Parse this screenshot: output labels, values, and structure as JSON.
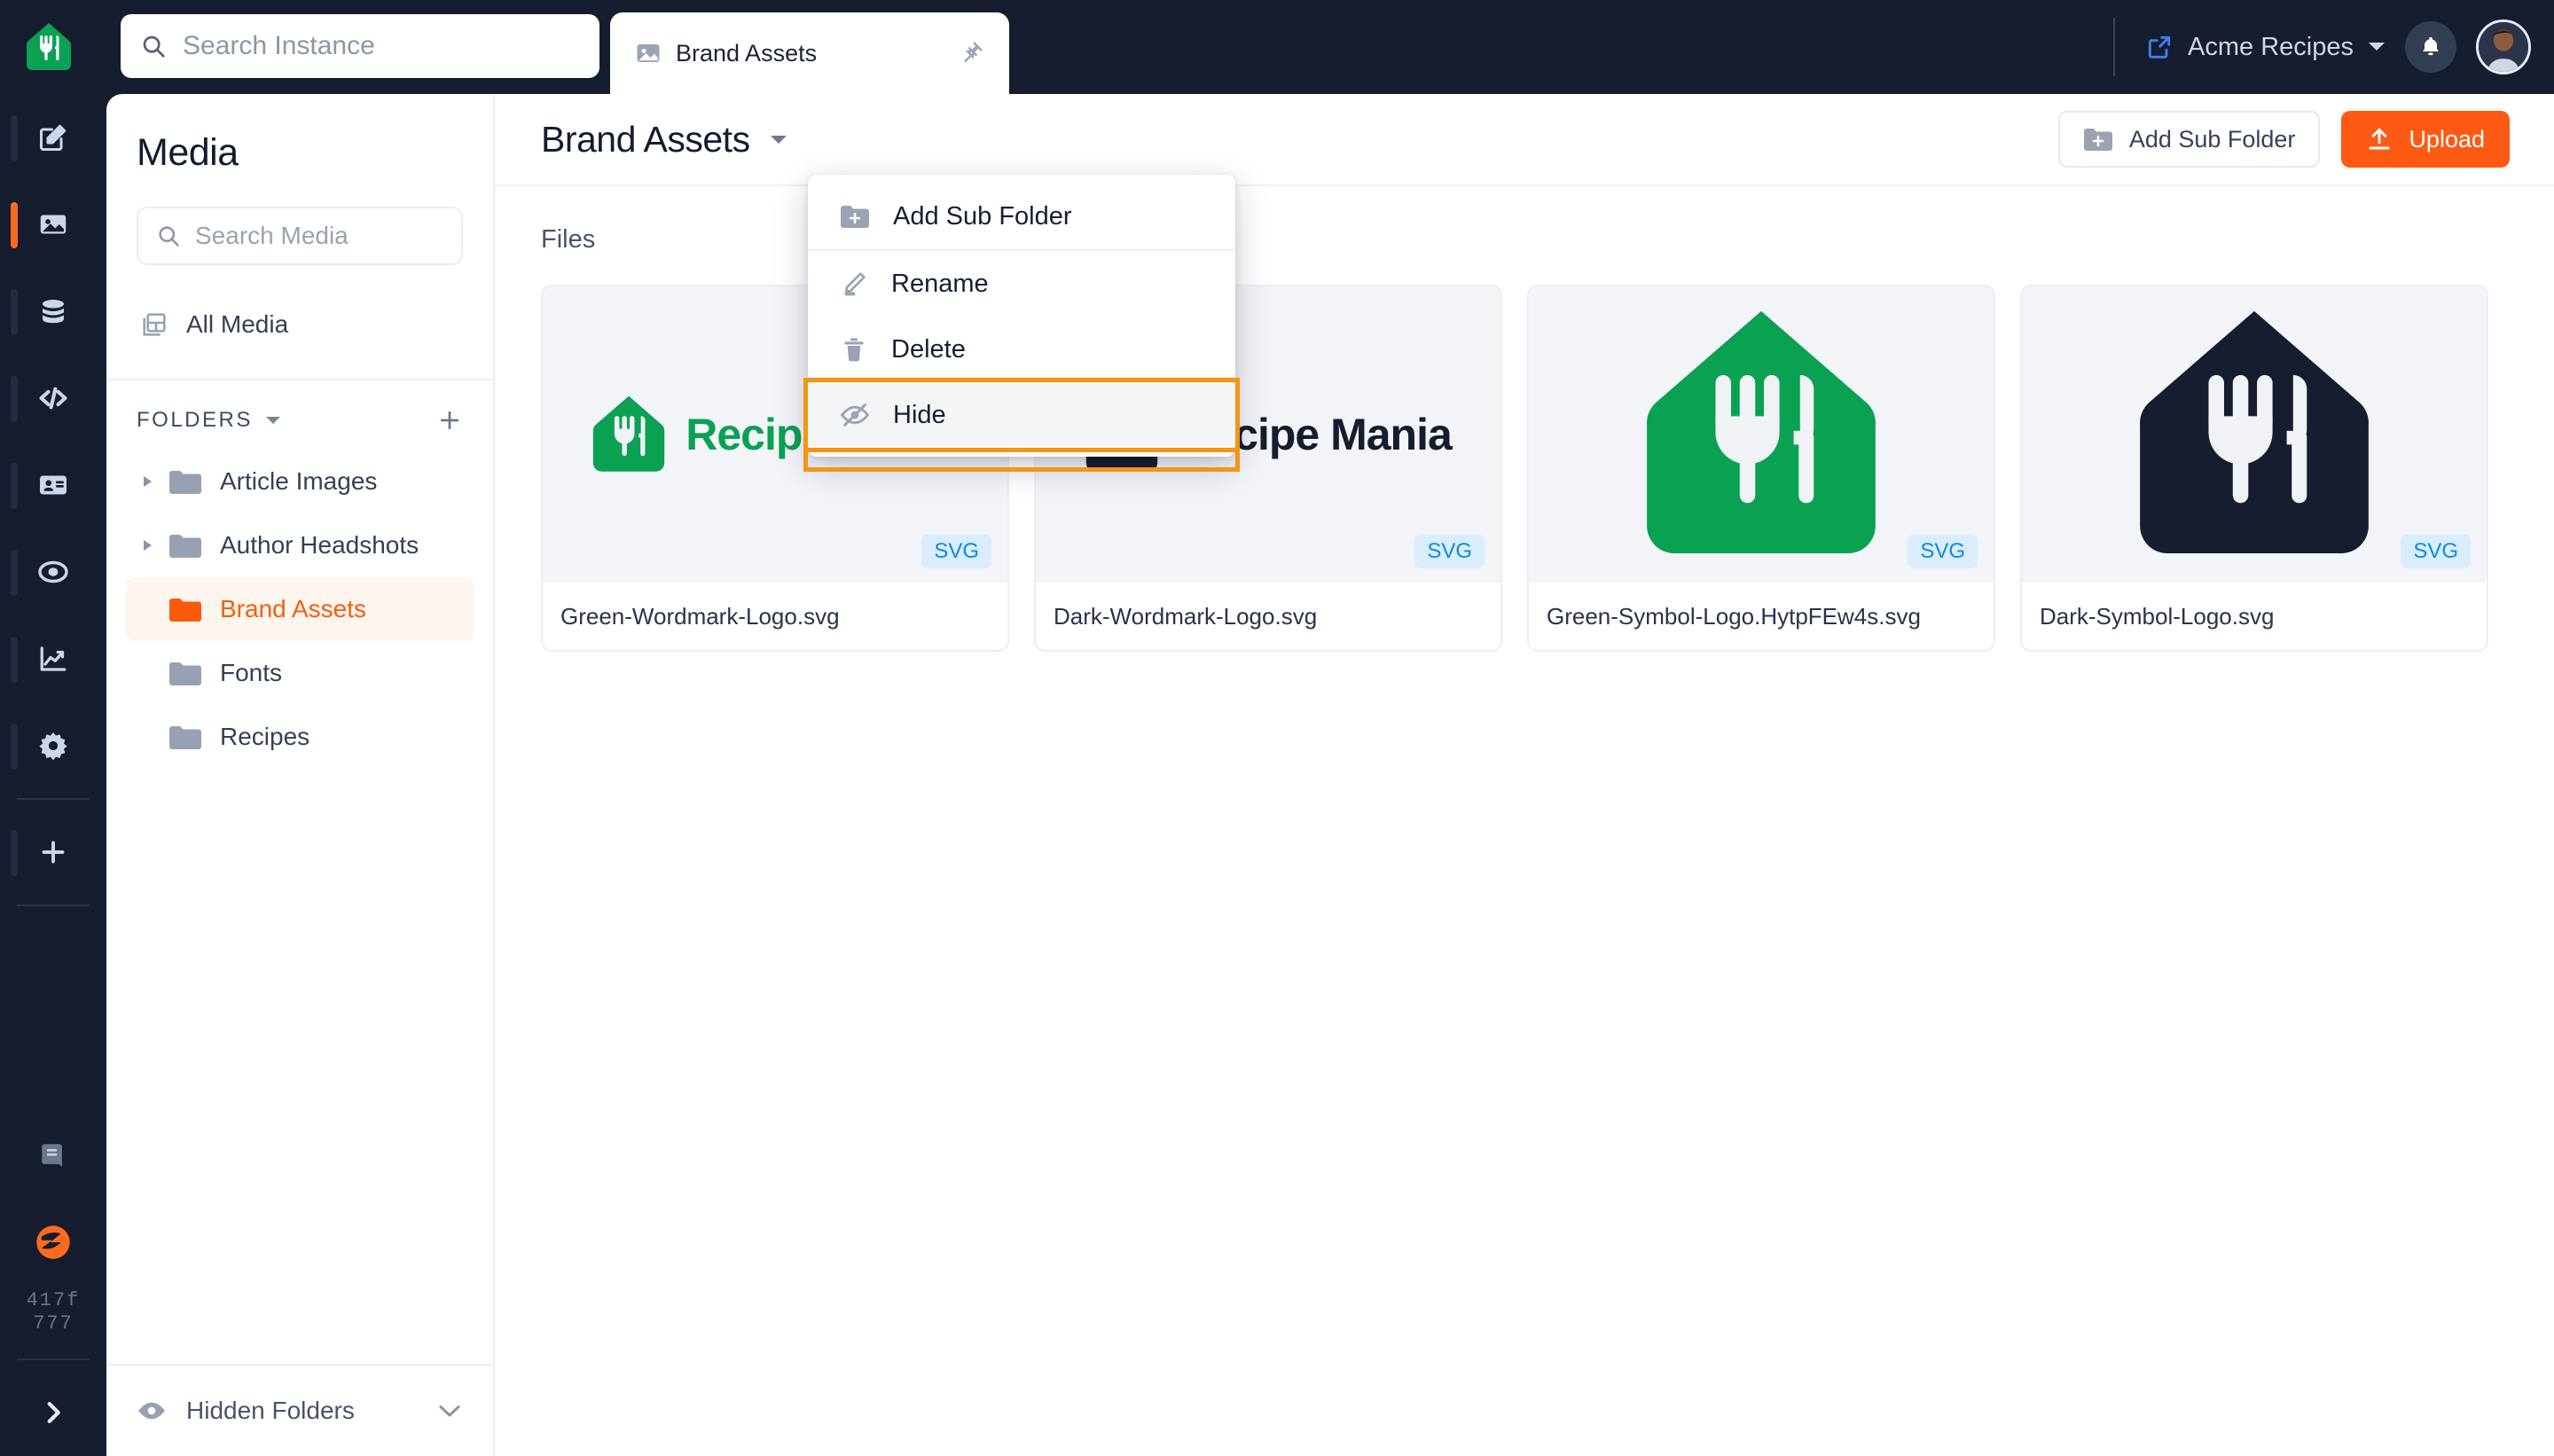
{
  "topbar": {
    "logo_icon": "recipe-mania-logo-icon",
    "search": {
      "placeholder": "Search Instance",
      "value": "",
      "icon": "search-icon"
    },
    "tab": {
      "label": "Brand Assets",
      "icon": "image-icon",
      "pin_icon": "pin-icon"
    },
    "site_switcher": {
      "label": "Acme Recipes",
      "external_icon": "external-link-icon",
      "caret_icon": "chevron-down-icon"
    },
    "notifications_icon": "bell-icon",
    "avatar": "user-avatar"
  },
  "rail": {
    "items": [
      {
        "name": "compose",
        "icon": "edit-square-icon",
        "active": false
      },
      {
        "name": "assets",
        "icon": "image-icon",
        "active": true
      },
      {
        "name": "collections",
        "icon": "database-icon",
        "active": false
      },
      {
        "name": "fieldtypes",
        "icon": "code-icon",
        "active": false
      },
      {
        "name": "users",
        "icon": "id-card-icon",
        "active": false
      },
      {
        "name": "targeting",
        "icon": "target-icon",
        "active": false
      },
      {
        "name": "analytics",
        "icon": "chart-line-icon",
        "active": false
      },
      {
        "name": "settings",
        "icon": "gear-icon",
        "active": false
      },
      {
        "name": "add",
        "icon": "plus-icon",
        "active": false
      }
    ],
    "bottom": {
      "docs_icon": "book-icon",
      "product_icon": "statamic-logo-icon",
      "version_line1": "417f",
      "version_line2": "777",
      "expand_icon": "chevron-right-icon"
    }
  },
  "sidebar": {
    "title": "Media",
    "search": {
      "placeholder": "Search Media",
      "value": "",
      "icon": "search-icon"
    },
    "all_media": {
      "label": "All Media",
      "icon": "grid-layout-icon"
    },
    "folders_header": {
      "label": "FOLDERS",
      "caret_icon": "caret-down-icon",
      "add_icon": "plus-icon"
    },
    "folders": [
      {
        "label": "Article Images",
        "expandable": true,
        "selected": false
      },
      {
        "label": "Author Headshots",
        "expandable": true,
        "selected": false
      },
      {
        "label": "Brand Assets",
        "expandable": false,
        "selected": true
      },
      {
        "label": "Fonts",
        "expandable": false,
        "selected": false
      },
      {
        "label": "Recipes",
        "expandable": false,
        "selected": false
      }
    ],
    "hidden_folders": {
      "label": "Hidden Folders",
      "icon": "eye-icon",
      "chevron_icon": "chevron-down-icon"
    }
  },
  "main": {
    "title": "Brand Assets",
    "title_caret_icon": "caret-down-icon",
    "add_sub_folder_button": {
      "label": "Add Sub Folder",
      "icon": "folder-plus-icon"
    },
    "upload_button": {
      "label": "Upload",
      "icon": "upload-icon"
    },
    "files_label": "Files",
    "files": [
      {
        "name": "Green-Wordmark-Logo.svg",
        "badge": "SVG",
        "kind": "wordmark",
        "mark_color": "#0ba152",
        "text": "Recipe Mania",
        "text_color": "#0ba152"
      },
      {
        "name": "Dark-Wordmark-Logo.svg",
        "badge": "SVG",
        "kind": "wordmark",
        "mark_color": "#151d2e",
        "text": "Recipe Mania",
        "text_color": "#151d2e"
      },
      {
        "name": "Green-Symbol-Logo.HytpFEw4s.svg",
        "badge": "SVG",
        "kind": "symbol",
        "mark_color": "#0ba152",
        "text": "",
        "text_color": ""
      },
      {
        "name": "Dark-Symbol-Logo.svg",
        "badge": "SVG",
        "kind": "symbol",
        "mark_color": "#151d2e",
        "text": "",
        "text_color": ""
      }
    ]
  },
  "context_menu": {
    "items": [
      {
        "label": "Add Sub Folder",
        "icon": "folder-plus-icon",
        "highlighted": false
      },
      {
        "label": "Rename",
        "icon": "pencil-icon",
        "highlighted": false
      },
      {
        "label": "Delete",
        "icon": "trash-icon",
        "highlighted": false
      },
      {
        "label": "Hide",
        "icon": "eye-off-icon",
        "highlighted": true
      }
    ]
  },
  "colors": {
    "accent_orange": "#ff5a13",
    "highlight_ring": "#f59415",
    "brand_green": "#0ba152",
    "dark_navy": "#151d2e",
    "badge_blue": "#0e8ae0"
  }
}
